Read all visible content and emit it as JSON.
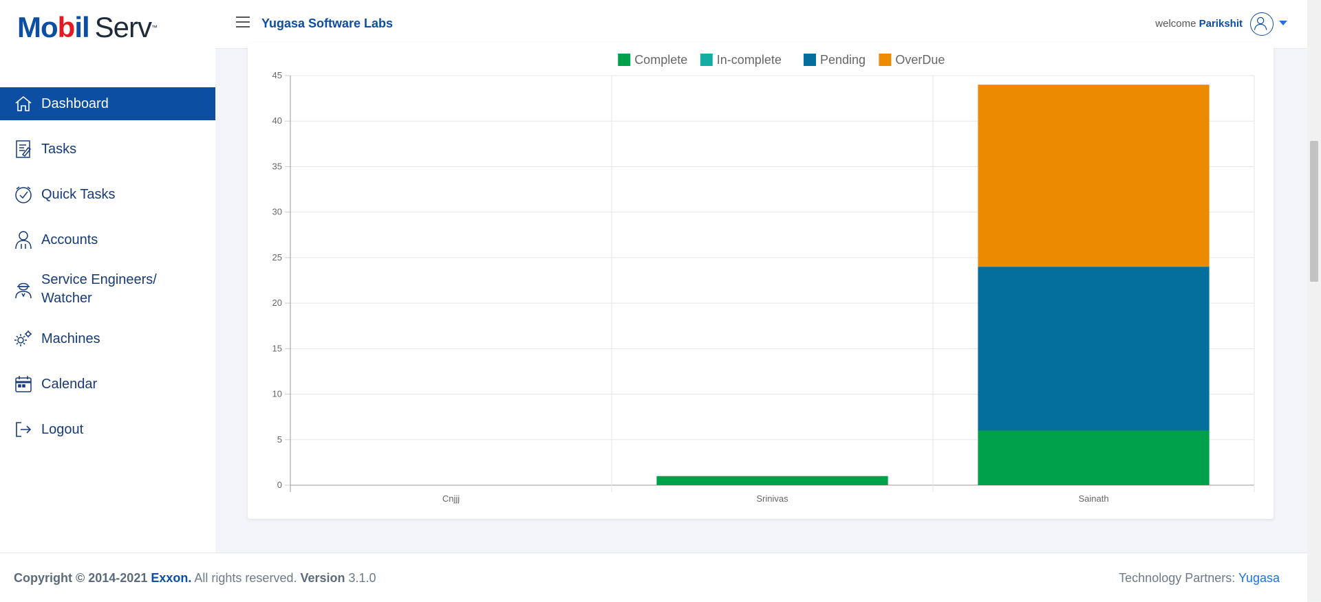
{
  "logo": {
    "part1": "Mo",
    "part2": "b",
    "part3": "il",
    "part4": "Serv",
    "tm": "™"
  },
  "sidebar": {
    "items": [
      {
        "label": "Dashboard",
        "icon": "home-icon",
        "active": true
      },
      {
        "label": "Tasks",
        "icon": "tasks-icon"
      },
      {
        "label": "Quick Tasks",
        "icon": "quick-tasks-icon"
      },
      {
        "label": "Accounts",
        "icon": "accounts-icon"
      },
      {
        "label": "Service Engineers/ Watcher",
        "line1": "Service Engineers/",
        "line2": "Watcher",
        "icon": "engineer-icon"
      },
      {
        "label": "Machines",
        "icon": "gears-icon"
      },
      {
        "label": "Calendar",
        "icon": "calendar-icon"
      },
      {
        "label": "Logout",
        "icon": "logout-icon"
      }
    ]
  },
  "header": {
    "company": "Yugasa Software Labs",
    "welcome": "welcome",
    "user": "Parikshit"
  },
  "chart_data": {
    "type": "bar",
    "stacked": true,
    "categories": [
      "Cnjjj",
      "Srinivas",
      "Sainath"
    ],
    "series": [
      {
        "name": "Complete",
        "color": "#00a14b",
        "values": [
          0,
          1,
          6
        ]
      },
      {
        "name": "In-complete",
        "color": "#13ada3",
        "values": [
          0,
          0,
          0
        ]
      },
      {
        "name": "Pending",
        "color": "#046e9c",
        "values": [
          0,
          0,
          18
        ]
      },
      {
        "name": "OverDue",
        "color": "#ec8b01",
        "values": [
          0,
          0,
          20
        ]
      }
    ],
    "ylim": [
      0,
      45
    ],
    "yticks": [
      0,
      5,
      10,
      15,
      20,
      25,
      30,
      35,
      40,
      45
    ],
    "legend": "top-center",
    "grid": true
  },
  "footer": {
    "copyright": "Copyright © 2014-2021",
    "company": "Exxon.",
    "rights": "All rights reserved.",
    "version_label": "Version",
    "version": "3.1.0",
    "partners_label": "Technology Partners:",
    "partner": "Yugasa"
  }
}
